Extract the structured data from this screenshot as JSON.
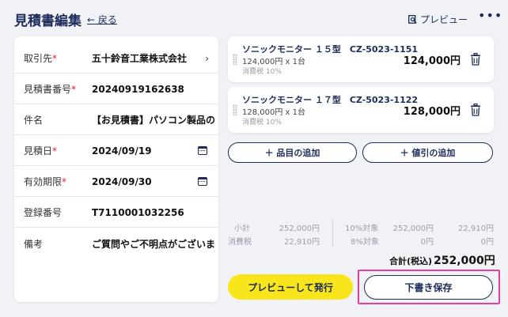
{
  "header": {
    "title": "見積書編集",
    "back_label": "← 戻る",
    "preview_label": "プレビュー",
    "more_label": "•••"
  },
  "form": {
    "required_mark": "*",
    "rows": [
      {
        "label": "取引先",
        "required": true,
        "value": "五十鈴音工業株式会社",
        "icon": "chevron-right-icon"
      },
      {
        "label": "見積書番号",
        "required": true,
        "value": "20240919162638"
      },
      {
        "label": "件名",
        "required": false,
        "value": "【お見積書】パソコン製品のま"
      },
      {
        "label": "見積日",
        "required": true,
        "value": "2024/09/19",
        "icon": "calendar-icon"
      },
      {
        "label": "有効期限",
        "required": true,
        "value": "2024/09/30",
        "icon": "calendar-icon"
      },
      {
        "label": "登録番号",
        "required": false,
        "value": "T7110001032256"
      },
      {
        "label": "備考",
        "required": false,
        "value": "ご質問やご不明点がございまし"
      }
    ]
  },
  "items": [
    {
      "name": "ソニックモニター １５型　CZ-5023-1151",
      "qty": "124,000円 x 1台",
      "tax": "消費税 10%",
      "amount": "124,000円"
    },
    {
      "name": "ソニックモニター １７型　CZ-5023-1122",
      "qty": "128,000円 x 1台",
      "tax": "消費税 10%",
      "amount": "128,000円"
    }
  ],
  "buttons": {
    "add_item": "＋ 品目の追加",
    "add_discount": "＋ 値引の追加",
    "preview_issue": "プレビューして発行",
    "save_draft": "下書き保存"
  },
  "summary": {
    "subtotal_label": "小計",
    "subtotal_value": "252,000円",
    "tax_label": "消費税",
    "tax_value": "22,910円",
    "rate10_label": "10%対象",
    "rate10_base": "252,000円",
    "rate10_tax": "22,910円",
    "rate8_label": "8%対象",
    "rate8_base": "0円",
    "rate8_tax": "0円",
    "total_label": "合計(税込)",
    "total_value": "252,000円"
  },
  "colors": {
    "navy": "#1c2b5a",
    "accent_yellow": "#f9e51b",
    "highlight_pink": "#e83ea0",
    "required_red": "#e02020",
    "background": "#f1f2f6"
  }
}
